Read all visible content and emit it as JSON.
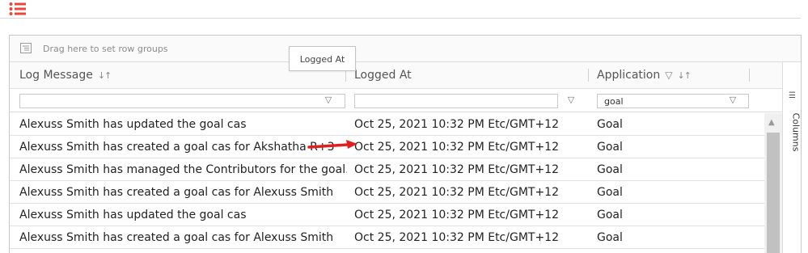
{
  "toolbar": {
    "menu_icon": "list-icon",
    "accent_color": "#e8473b"
  },
  "grid": {
    "group_panel_text": "Drag here to set row groups",
    "columns": [
      {
        "label": "Log Message",
        "sortable": true,
        "filter_value": ""
      },
      {
        "label": "Logged At",
        "sortable": false,
        "filter_value": ""
      },
      {
        "label": "Application",
        "sortable": true,
        "filter_value": "goal"
      }
    ],
    "rows": [
      {
        "message": "Alexuss Smith has updated the goal cas",
        "logged_at": "Oct 25, 2021 10:32 PM Etc/GMT+12",
        "application": "Goal"
      },
      {
        "message": "Alexuss Smith has created a goal cas for Akshatha R+3",
        "logged_at": "Oct 25, 2021 10:32 PM Etc/GMT+12",
        "application": "Goal"
      },
      {
        "message": "Alexuss Smith has managed the Contributors for the goal...",
        "logged_at": "Oct 25, 2021 10:32 PM Etc/GMT+12",
        "application": "Goal"
      },
      {
        "message": "Alexuss Smith has created a goal cas for Alexuss Smith",
        "logged_at": "Oct 25, 2021 10:32 PM Etc/GMT+12",
        "application": "Goal"
      },
      {
        "message": "Alexuss Smith has updated the goal cas",
        "logged_at": "Oct 25, 2021 10:32 PM Etc/GMT+12",
        "application": "Goal"
      },
      {
        "message": "Alexuss Smith has created a goal cas for Alexuss Smith",
        "logged_at": "Oct 25, 2021 10:32 PM Etc/GMT+12",
        "application": "Goal"
      }
    ],
    "side_panel_tab": "Columns",
    "tooltip": "Logged At"
  },
  "annotation": {
    "arrow_color": "#e02020"
  }
}
